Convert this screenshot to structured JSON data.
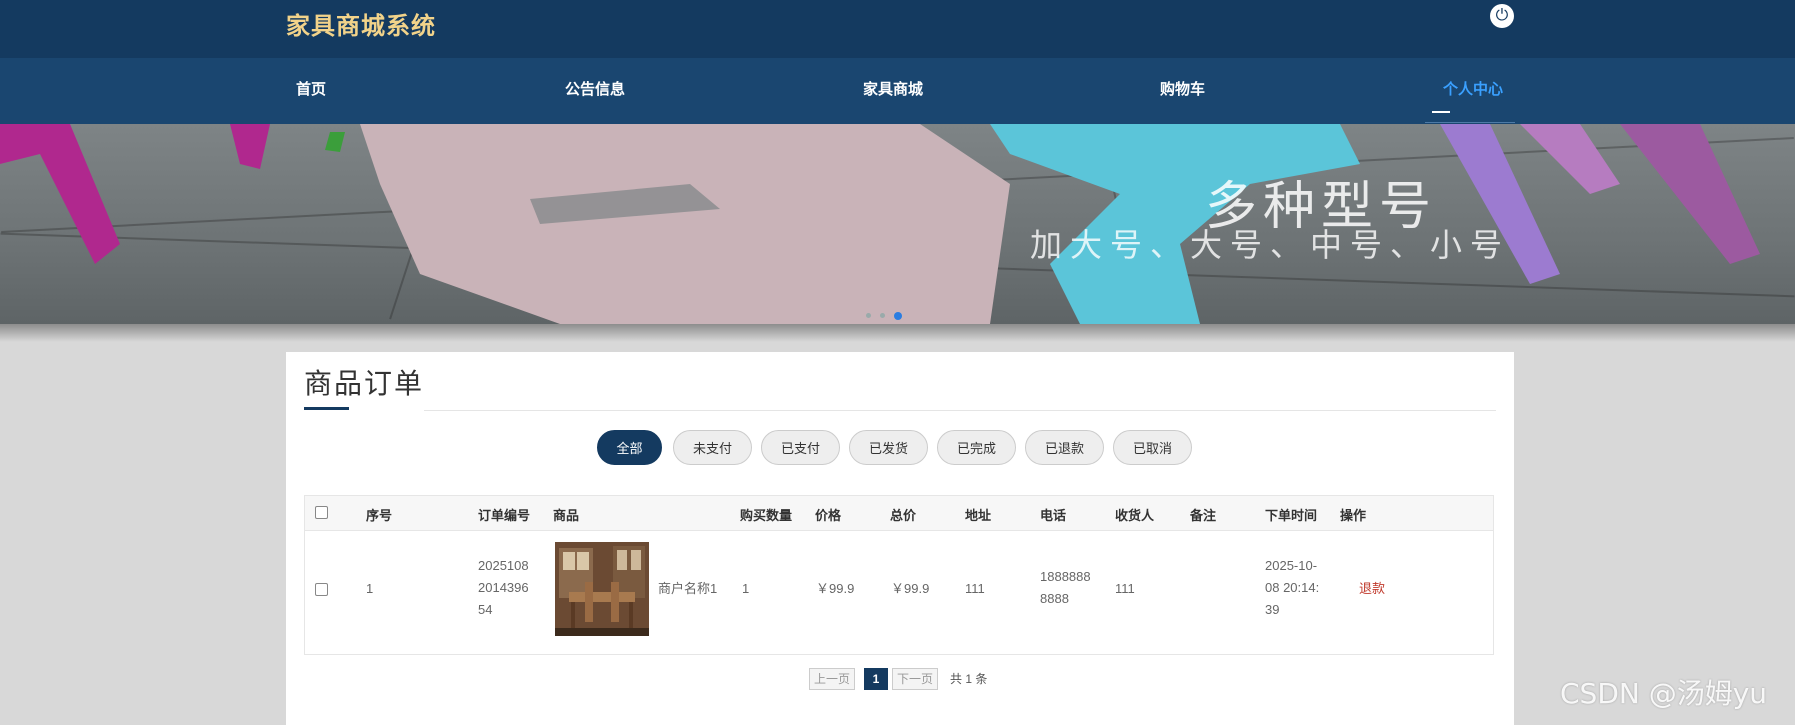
{
  "header": {
    "brand": "家具商城系统",
    "logout_icon": "power-icon"
  },
  "nav": {
    "items": [
      {
        "label": "首页"
      },
      {
        "label": "公告信息"
      },
      {
        "label": "家具商城"
      },
      {
        "label": "购物车"
      },
      {
        "label": "个人中心",
        "active": true
      }
    ]
  },
  "banner": {
    "title": "多种型号",
    "subtitle": "加大号、大号、中号、小号",
    "slides": 3,
    "active_slide": 3
  },
  "orders": {
    "title": "商品订单",
    "filters": [
      "全部",
      "未支付",
      "已支付",
      "已发货",
      "已完成",
      "已退款",
      "已取消"
    ],
    "active_filter": "全部",
    "columns": [
      "序号",
      "订单编号",
      "商品",
      "购买数量",
      "价格",
      "总价",
      "地址",
      "电话",
      "收货人",
      "备注",
      "下单时间",
      "操作"
    ],
    "rows": [
      {
        "index": "1",
        "order_no": [
          "2025108",
          "2014396",
          "54"
        ],
        "product_name": "商户名称1",
        "quantity": "1",
        "price": "￥99.9",
        "total": "￥99.9",
        "address": "111",
        "phone": [
          "1888888",
          "8888"
        ],
        "receiver": "111",
        "remark": "",
        "order_time": [
          "2025-10-",
          "08 20:14:",
          "39"
        ],
        "action": "退款"
      }
    ]
  },
  "pagination": {
    "prev": "上一页",
    "current": "1",
    "next": "下一页",
    "total": "共 1 条"
  },
  "watermark": "CSDN @汤姆yu",
  "colors": {
    "header_bg": "#143a60",
    "nav_bg": "#1a4670",
    "brand": "#f2d38a",
    "accent": "#3aa0ff",
    "danger": "#c0392b"
  }
}
